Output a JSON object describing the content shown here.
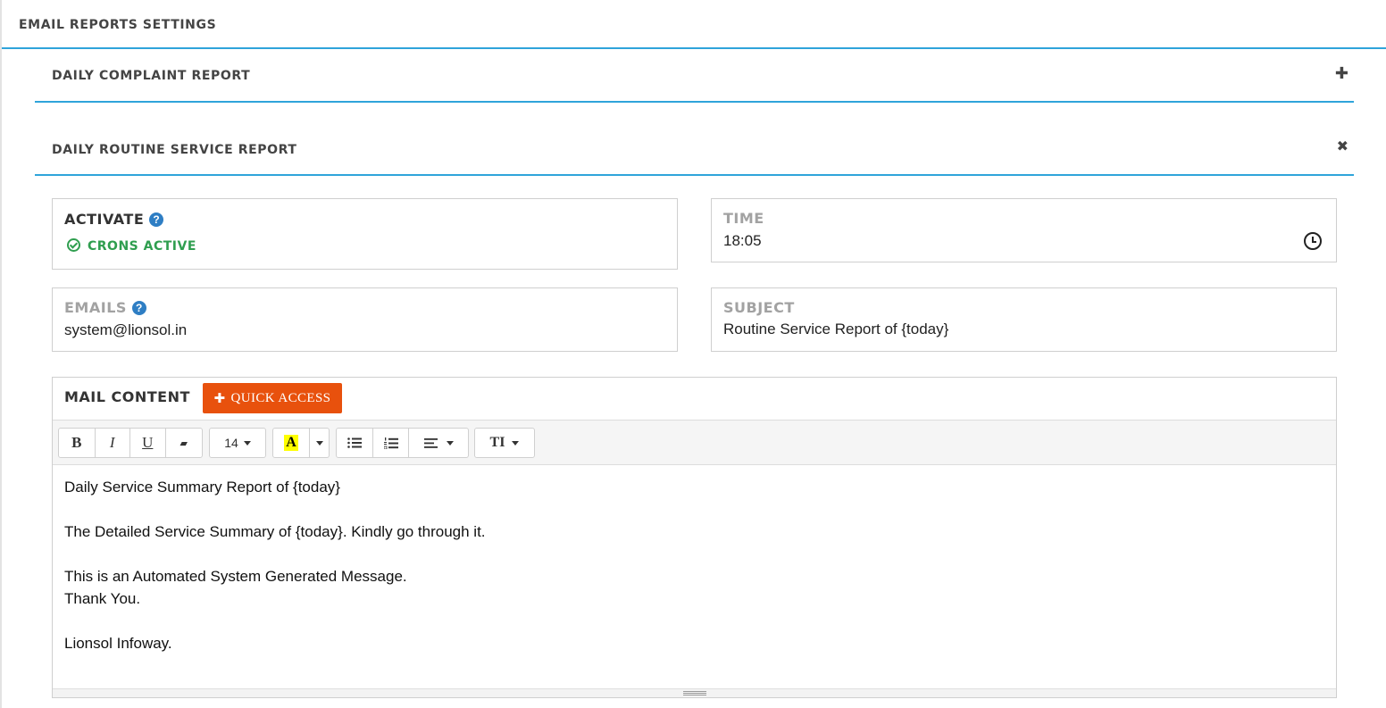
{
  "page": {
    "title": "EMAIL REPORTS SETTINGS"
  },
  "accordions": [
    {
      "title": "DAILY COMPLAINT REPORT",
      "toggle_icon": "plus-icon",
      "toggle_glyph": "✚",
      "expanded": false
    },
    {
      "title": "DAILY ROUTINE SERVICE REPORT",
      "toggle_icon": "close-icon",
      "toggle_glyph": "✖",
      "expanded": true
    }
  ],
  "form": {
    "activate": {
      "label": "ACTIVATE",
      "help_glyph": "?",
      "status": "CRONS ACTIVE",
      "status_color": "#2f9e4f"
    },
    "time": {
      "label": "TIME",
      "value": "18:05"
    },
    "emails": {
      "label": "EMAILS",
      "help_glyph": "?",
      "value": "system@lionsol.in"
    },
    "subject": {
      "label": "SUBJECT",
      "value": "Routine Service Report of {today}"
    },
    "mail_content": {
      "label": "MAIL CONTENT",
      "quick_access": {
        "plus": "✚",
        "label": "QUICK ACCESS",
        "color": "#e8510d"
      },
      "toolbar": {
        "bold": "B",
        "italic": "I",
        "underline": "U",
        "eraser": "▰",
        "font_size": "14",
        "highlight": "A",
        "text_height": "TI"
      },
      "body": [
        "Daily Service Summary Report of {today}",
        "",
        "The Detailed Service Summary of {today}. Kindly go through it.",
        "",
        "This is an Automated System Generated Message.",
        "Thank You.",
        "",
        "Lionsol Infoway."
      ]
    }
  },
  "colors": {
    "accent": "#2fa4da",
    "help": "#2e7ec4"
  }
}
